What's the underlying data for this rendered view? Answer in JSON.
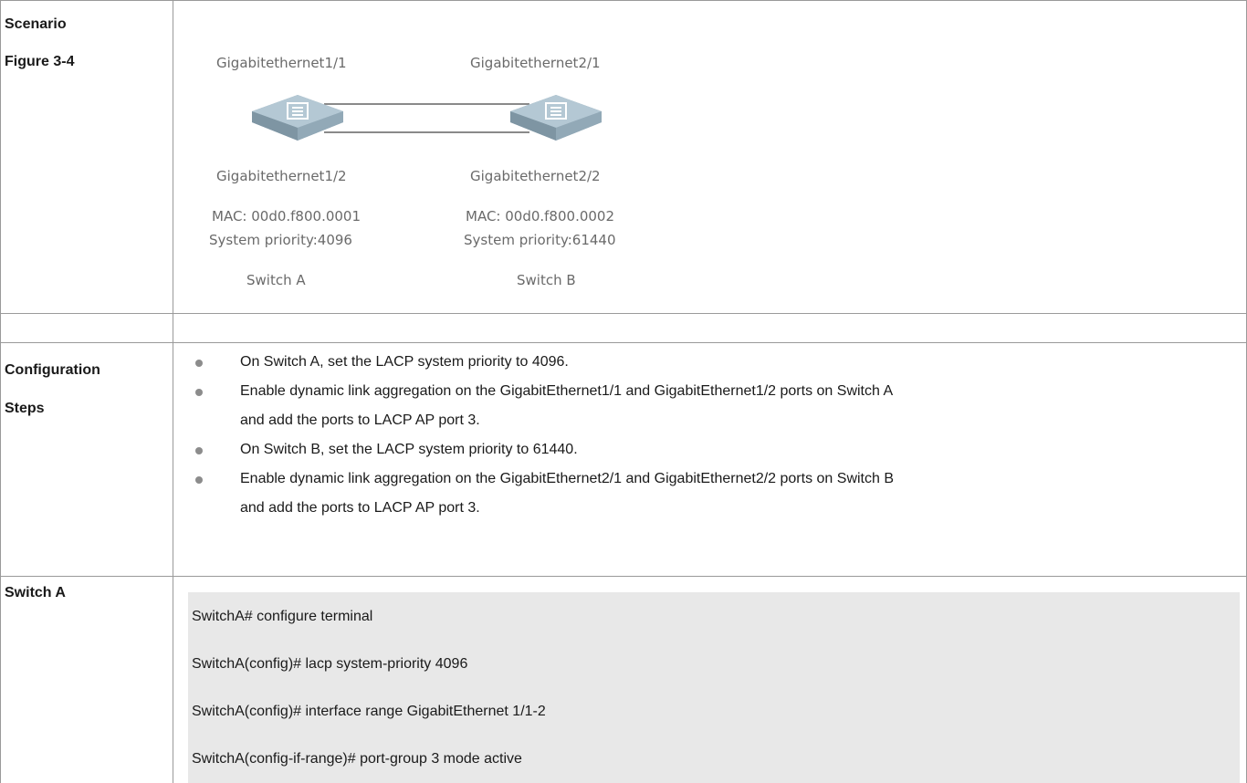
{
  "labels": {
    "scenario": "Scenario",
    "figure": "Figure 3-4",
    "configuration": "Configuration",
    "steps": "Steps",
    "switch_a": "Switch A"
  },
  "diagram": {
    "switch_a": {
      "port_top": "Gigabitethernet1/1",
      "port_bottom": "Gigabitethernet1/2",
      "mac": "MAC: 00d0.f800.0001",
      "priority": "System priority:4096",
      "name": "Switch A"
    },
    "switch_b": {
      "port_top": "Gigabitethernet2/1",
      "port_bottom": "Gigabitethernet2/2",
      "mac": "MAC: 00d0.f800.0002",
      "priority": "System priority:61440",
      "name": "Switch B"
    },
    "icon_color": "#9db5c4"
  },
  "steps": [
    {
      "line1": "On Switch A, set the LACP system priority to 4096.",
      "line2": ""
    },
    {
      "line1": "Enable dynamic link aggregation on the GigabitEthernet1/1 and GigabitEthernet1/2 ports on Switch A",
      "line2": "and add the ports to LACP AP port 3."
    },
    {
      "line1": "On Switch B, set the LACP system priority to 61440.",
      "line2": ""
    },
    {
      "line1": "Enable dynamic link aggregation on the GigabitEthernet2/1 and GigabitEthernet2/2 ports on Switch B",
      "line2": "and add the ports to LACP AP port 3."
    }
  ],
  "code": [
    "SwitchA# configure terminal",
    "SwitchA(config)# lacp system-priority 4096",
    "SwitchA(config)# interface range GigabitEthernet 1/1-2",
    "SwitchA(config-if-range)# port-group 3 mode active"
  ]
}
